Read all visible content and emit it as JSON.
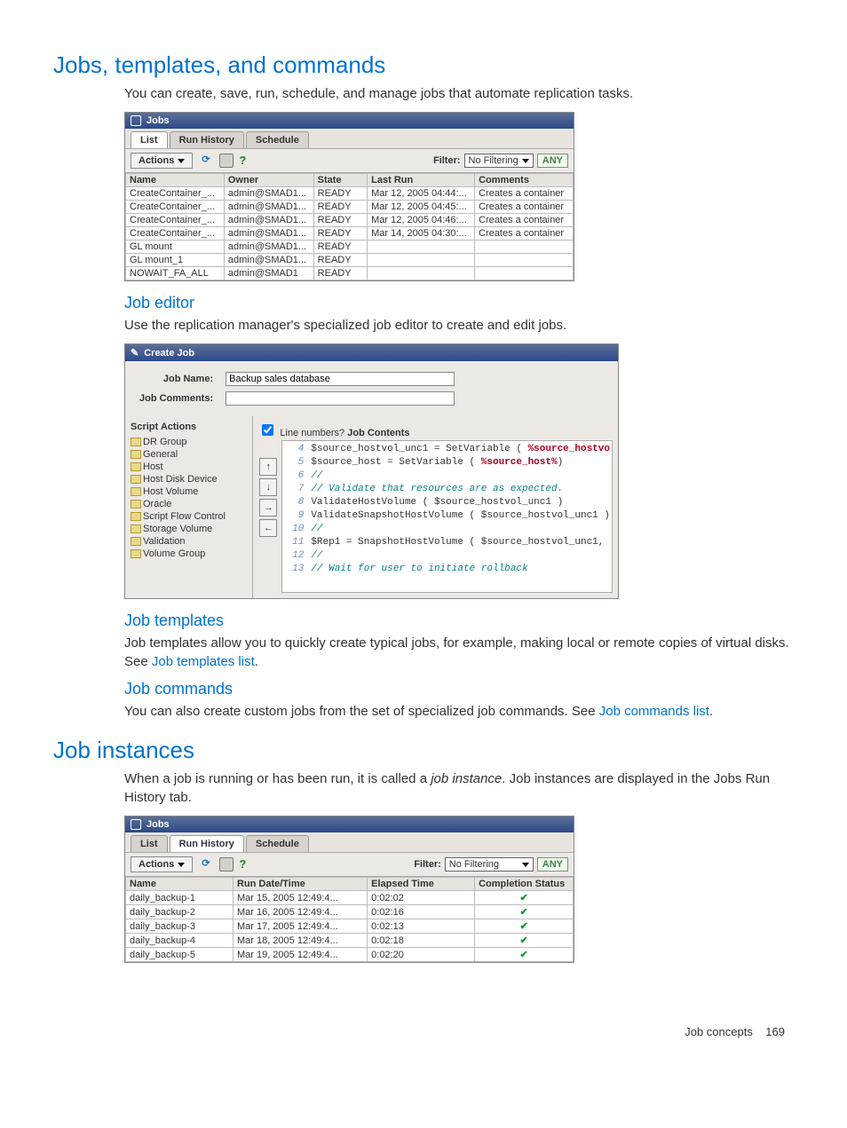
{
  "h_jobs": "Jobs, templates, and commands",
  "p_jobs": "You can create, save, run, schedule, and manage jobs that automate replication tasks.",
  "h_editor": "Job editor",
  "p_editor": "Use the replication manager's specialized job editor to create and edit jobs.",
  "h_templates": "Job templates",
  "p_templates_a": "Job templates allow you to quickly create typical jobs, for example, making local or remote copies of virtual disks. See ",
  "link_templates": "Job templates list",
  "h_cmds": "Job commands",
  "p_cmds_a": "You can also create custom jobs from the set of specialized job commands. See ",
  "link_cmds": "Job commands list",
  "h_inst": "Job instances",
  "p_inst_a": "When a job is running or has been run, it is called a ",
  "p_inst_i": "job instance",
  "p_inst_b": ". Job instances are displayed in the Jobs Run History tab.",
  "footer_a": "Job concepts",
  "footer_b": "169",
  "jobs_panel": {
    "title": "Jobs",
    "tabs": [
      "List",
      "Run History",
      "Schedule"
    ],
    "activeTab": 0,
    "actions": "Actions",
    "filterLabel": "Filter:",
    "filterVal": "No Filtering",
    "any": "ANY",
    "cols": [
      "Name",
      "Owner",
      "State",
      "Last Run",
      "Comments"
    ],
    "rows": [
      [
        "CreateContainer_...",
        "admin@SMAD1...",
        "READY",
        "Mar 12, 2005 04:44:...",
        "Creates a container"
      ],
      [
        "CreateContainer_...",
        "admin@SMAD1...",
        "READY",
        "Mar 12, 2005 04:45:...",
        "Creates a container"
      ],
      [
        "CreateContainer_...",
        "admin@SMAD1...",
        "READY",
        "Mar 12, 2005 04:46:...",
        "Creates a container"
      ],
      [
        "CreateContainer_...",
        "admin@SMAD1...",
        "READY",
        "Mar 14, 2005 04:30:...",
        "Creates a container"
      ],
      [
        "GL mount",
        "admin@SMAD1...",
        "READY",
        "",
        ""
      ],
      [
        "GL mount_1",
        "admin@SMAD1...",
        "READY",
        "",
        ""
      ],
      [
        "NOWAIT_FA_ALL",
        "admin@SMAD1",
        "READY",
        "",
        ""
      ]
    ]
  },
  "editor_panel": {
    "title": "Create Job",
    "jobNameLabel": "Job Name:",
    "jobNameVal": "Backup sales database",
    "jobCommentsLabel": "Job Comments:",
    "scriptActions": "Script Actions",
    "folders": [
      "DR Group",
      "General",
      "Host",
      "Host Disk Device",
      "Host Volume",
      "Oracle",
      "Script Flow Control",
      "Storage Volume",
      "Validation",
      "Volume Group"
    ],
    "lineNumbers": "Line numbers?",
    "jobContents": "Job Contents",
    "lines": [
      {
        "n": "4",
        "html": "$source_hostvol_unc1 = SetVariable ( <span class='kw-red'>%source_hostvo</span>"
      },
      {
        "n": "5",
        "html": "$source_host = SetVariable ( <span class='kw-red'>%source_host%</span>)"
      },
      {
        "n": "6",
        "html": "<span class='kw-teal'>//</span>"
      },
      {
        "n": "7",
        "html": "<span class='kw-teal'>// Validate that resources are as expected.</span>"
      },
      {
        "n": "8",
        "html": "ValidateHostVolume ( $source_hostvol_unc1 )"
      },
      {
        "n": "9",
        "html": "ValidateSnapshotHostVolume ( $source_hostvol_unc1 )"
      },
      {
        "n": "10",
        "html": "<span class='kw-teal'>//</span>"
      },
      {
        "n": "11",
        "html": "$Rep1 = SnapshotHostVolume ( $source_hostvol_unc1,"
      },
      {
        "n": "12",
        "html": "<span class='kw-teal'>//</span>"
      },
      {
        "n": "13",
        "html": "<span class='kw-teal'>// Wait for user to initiate rollback</span>"
      }
    ]
  },
  "hist_panel": {
    "title": "Jobs",
    "tabs": [
      "List",
      "Run History",
      "Schedule"
    ],
    "activeTab": 1,
    "actions": "Actions",
    "filterLabel": "Filter:",
    "filterVal": "No Filtering",
    "any": "ANY",
    "cols": [
      "Name",
      "Run Date/Time",
      "Elapsed Time",
      "Completion Status"
    ],
    "rows": [
      [
        "daily_backup-1",
        "Mar 15, 2005 12:49:4...",
        "0:02:02",
        "✓"
      ],
      [
        "daily_backup-2",
        "Mar 16, 2005 12:49:4...",
        "0:02:16",
        "✓"
      ],
      [
        "daily_backup-3",
        "Mar 17, 2005 12:49:4...",
        "0:02:13",
        "✓"
      ],
      [
        "daily_backup-4",
        "Mar 18, 2005 12:49:4...",
        "0:02:18",
        "✓"
      ],
      [
        "daily_backup-5",
        "Mar 19, 2005 12:49:4...",
        "0:02:20",
        "✓"
      ]
    ]
  }
}
